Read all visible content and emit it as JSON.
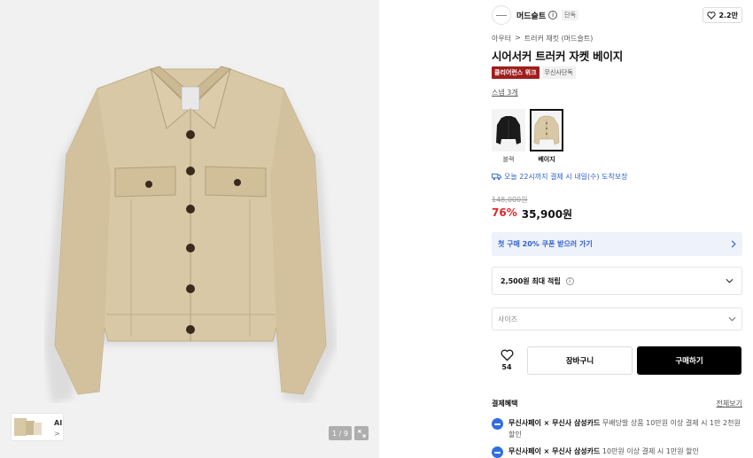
{
  "gallery": {
    "thumb_ai_label": "AI",
    "thumb_ai_arrow": ">",
    "pager": "1 / 9"
  },
  "brand": {
    "name": "머드슬트",
    "info": "i",
    "exclusive": "단독",
    "likes": "2.2만"
  },
  "breadcrumb": {
    "category": "아우터",
    "separator": ">",
    "subcategory": "트러커 재킷 (머드슬트)"
  },
  "product": {
    "title": "시어서커 트러커 자켓 베이지",
    "badge_red": "클리어런스 위크",
    "badge_grey": "무신사단독",
    "snap": "스냅 3개"
  },
  "swatches": [
    {
      "label": "블랙",
      "color": "#1a1a1a"
    },
    {
      "label": "베이지",
      "color": "#d9c9a8"
    }
  ],
  "delivery": "오늘 22시까지 결제 시 내일(수) 도착보장",
  "price": {
    "original": "148,000원",
    "discount": "76%",
    "sale": "35,900원"
  },
  "coupon": "첫 구매 20% 쿠폰 받으러 가기",
  "points": {
    "label": "2,500원 최대 적립",
    "info": "i"
  },
  "size_select": {
    "placeholder": "사이즈"
  },
  "actions": {
    "wish_count": "54",
    "cart": "장바구니",
    "buy": "구매하기"
  },
  "benefits": {
    "title": "결제혜택",
    "more": "전체보기",
    "items": [
      {
        "bold": "무신사페이 × 무신사 삼성카드",
        "text": " 무배당발 상품 10만원 이상 결제 시 1만 2천원 할인"
      },
      {
        "bold": "무신사페이 × 무신사 삼성카드",
        "text": " 10만원 이상 결제 시 1만원 할인"
      }
    ]
  },
  "colors": {
    "accent_blue": "#2f5fd0",
    "discount_red": "#e4262b",
    "badge_red": "#a01d1d",
    "jacket": "#d9c9a8"
  }
}
